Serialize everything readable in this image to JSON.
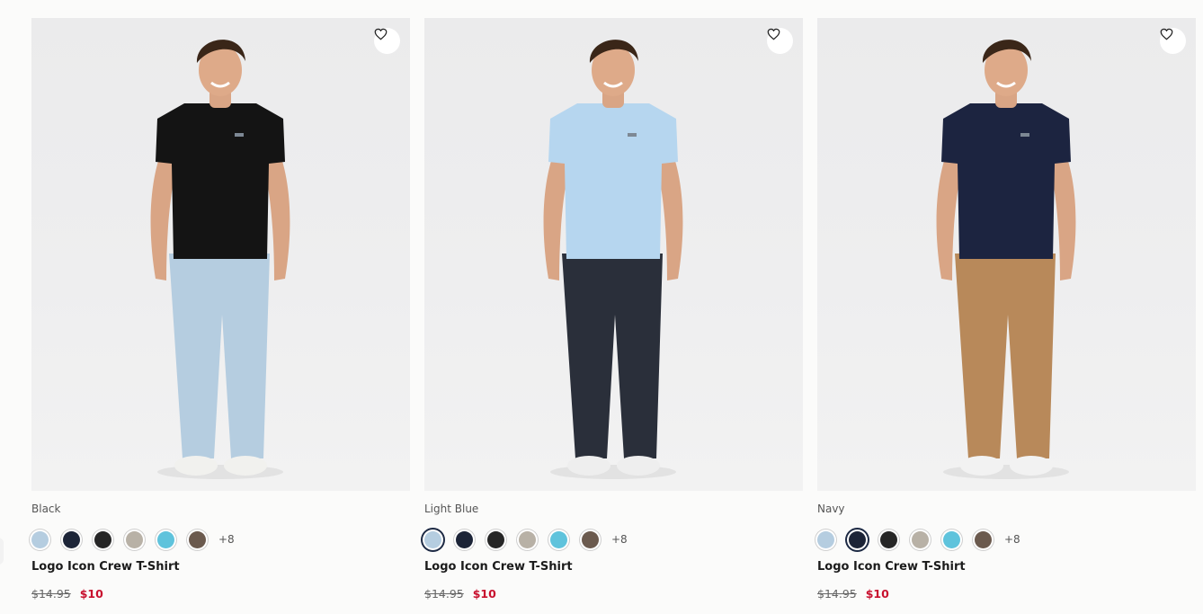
{
  "products": [
    {
      "color_name": "Black",
      "title": "Logo Icon Crew T-Shirt",
      "price_old": "$14.95",
      "price_new": "$10",
      "more_colors": "+8",
      "shirt_color": "#141414",
      "pants_color": "#b5cde0",
      "shoe_color": "#f1f1ee",
      "selected_swatch": -1,
      "swatches": [
        "#b5cde0",
        "#1c2437",
        "#262626",
        "#b8b1a6",
        "#5fc3dc",
        "#6b5a4e"
      ]
    },
    {
      "color_name": "Light Blue",
      "title": "Logo Icon Crew T-Shirt",
      "price_old": "$14.95",
      "price_new": "$10",
      "more_colors": "+8",
      "shirt_color": "#b6d6ef",
      "pants_color": "#2a2f3a",
      "shoe_color": "#eeeeee",
      "selected_swatch": 0,
      "swatches": [
        "#b5cde0",
        "#1c2437",
        "#262626",
        "#b8b1a6",
        "#5fc3dc",
        "#6b5a4e"
      ]
    },
    {
      "color_name": "Navy",
      "title": "Logo Icon Crew T-Shirt",
      "price_old": "$14.95",
      "price_new": "$10",
      "more_colors": "+8",
      "shirt_color": "#1c2440",
      "pants_color": "#b8895a",
      "shoe_color": "#f2f2f2",
      "selected_swatch": 1,
      "swatches": [
        "#b5cde0",
        "#1c2437",
        "#262626",
        "#b8b1a6",
        "#5fc3dc",
        "#6b5a4e"
      ]
    }
  ],
  "icons": {
    "favorite": "heart-outline-icon"
  }
}
